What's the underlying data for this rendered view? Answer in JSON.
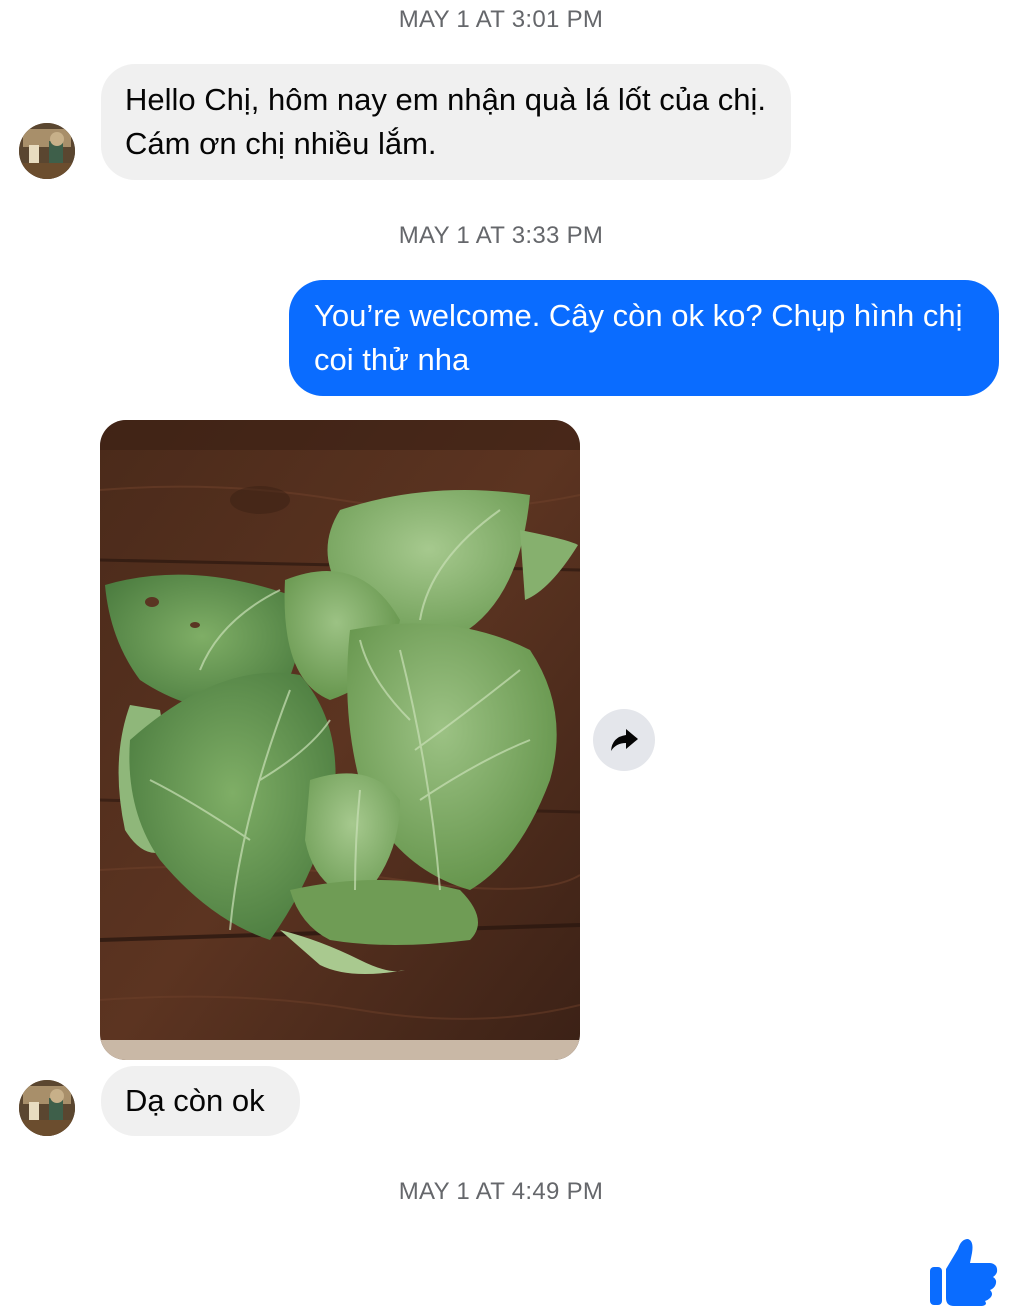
{
  "conversation": {
    "timestamps": [
      "MAY 1 AT 3:01 PM",
      "MAY 1 AT 3:33 PM",
      "MAY 1 AT 4:49 PM"
    ],
    "messages": [
      {
        "sender": "them",
        "text": "Hello Chị, hôm nay em nhận quà lá lốt của chị.  Cám ơn chị nhiều lắm."
      },
      {
        "sender": "me",
        "text": "You’re welcome. Cây còn ok ko? Chụp hình chị coi thử nha"
      },
      {
        "sender": "them",
        "type": "photo",
        "subject": "betel leaf plant (lá lốt) on wooden table"
      },
      {
        "sender": "them",
        "text": "Dạ còn ok"
      }
    ]
  },
  "icons": {
    "share": "share-forward-icon",
    "like": "thumbs-up-icon",
    "avatar": "contact-avatar"
  },
  "colors": {
    "outgoing_bubble": "#0a6cff",
    "incoming_bubble": "#f0f0f0",
    "timestamp": "#65676b",
    "like": "#0a6cff"
  }
}
